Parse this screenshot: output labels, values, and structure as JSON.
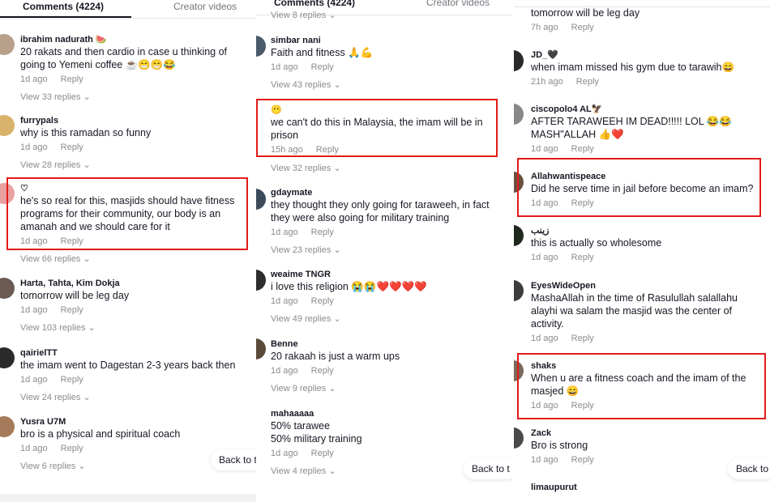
{
  "panel1": {
    "tabs": {
      "comments": "Comments (4224)",
      "creator": "Creator videos"
    },
    "back_label": "Back to t",
    "comments": [
      {
        "author": "ibrahim nadurath 🍉",
        "text": "20 rakats and then cardio in case u thinking of going to Yemeni coffee ☕😁😁😂",
        "time": "1d ago",
        "reply": "Reply",
        "view": "View 33 replies ⌄"
      },
      {
        "author": "furrypals",
        "text": "why is this ramadan so funny",
        "time": "1d ago",
        "reply": "Reply",
        "view": "View 28 replies ⌄"
      },
      {
        "author": "♡",
        "text": "he's so real for this, masjids should have fitness programs for their community, our body is an amanah and we should care for it",
        "time": "1d ago",
        "reply": "Reply",
        "view": "View 66 replies ⌄"
      },
      {
        "author": "Harta, Tahta, Kim Dokja",
        "text": "tomorrow will be leg day",
        "time": "1d ago",
        "reply": "Reply",
        "view": "View 103 replies ⌄"
      },
      {
        "author": "qairielTT",
        "text": "the imam went to Dagestan 2-3 years back then",
        "time": "1d ago",
        "reply": "Reply",
        "view": "View 24 replies ⌄"
      },
      {
        "author": "Yusra U7M",
        "text": "bro is a physical and spiritual coach",
        "time": "1d ago",
        "reply": "Reply",
        "view": "View 6 replies ⌄"
      }
    ]
  },
  "panel2": {
    "tabs": {
      "comments": "Comments (4224)",
      "creator": "Creator videos"
    },
    "top_partial": "View 8 replies ⌄",
    "back_label": "Back to t",
    "comments": [
      {
        "author": "simbar nani",
        "text": "Faith and fitness 🙏💪",
        "time": "1d ago",
        "reply": "Reply",
        "view": "View 43 replies ⌄"
      },
      {
        "author": "😶",
        "text": "we can't do this in Malaysia, the imam will be in prison",
        "time": "15h ago",
        "reply": "Reply",
        "view": "View 32 replies ⌄"
      },
      {
        "author": "gdaymate",
        "text": "they thought they only going for taraweeh, in fact they were also going for military training",
        "time": "1d ago",
        "reply": "Reply",
        "view": "View 23 replies ⌄"
      },
      {
        "author": "weaime TNGR",
        "text": "i love this religion 😭😭❤️❤️❤️❤️",
        "time": "1d ago",
        "reply": "Reply",
        "view": "View 49 replies ⌄"
      },
      {
        "author": "Benne",
        "text": "20 rakaah is just a warm ups",
        "time": "1d ago",
        "reply": "Reply",
        "view": "View 9 replies ⌄"
      },
      {
        "author": "mahaaaaa",
        "text": "50% tarawee\n50% military training",
        "time": "1d ago",
        "reply": "Reply",
        "view": "View 4 replies ⌄"
      }
    ]
  },
  "panel3": {
    "back_label": "Back to",
    "comments": [
      {
        "author": "",
        "text": "tomorrow will be leg day",
        "time": "7h ago",
        "reply": "Reply"
      },
      {
        "author": "JD_🖤",
        "text": "when imam missed his gym due to tarawih😄",
        "time": "21h ago",
        "reply": "Reply"
      },
      {
        "author": "ciscopolo4 AL🦅",
        "text": "AFTER TARAWEEH IM DEAD!!!!! LOL 😂😂 MASH\"ALLAH 👍❤️",
        "time": "1d ago",
        "reply": "Reply"
      },
      {
        "author": "Allahwantispeace",
        "text": "Did he serve time in jail before become an imam?",
        "time": "1d ago",
        "reply": "Reply"
      },
      {
        "author": "زينب",
        "text": "this is actually so wholesome",
        "time": "1d ago",
        "reply": "Reply"
      },
      {
        "author": "EyesWideOpen",
        "text": "MashaAllah in the time of Rasulullah salallahu alayhi wa salam the masjid was the center of activity.",
        "time": "1d ago",
        "reply": "Reply"
      },
      {
        "author": "shaks",
        "text": "When u are a fitness coach and the imam of the masjed 😄",
        "time": "1d ago",
        "reply": "Reply"
      },
      {
        "author": "Zack",
        "text": "Bro is strong",
        "time": "1d ago",
        "reply": "Reply"
      },
      {
        "author": "limaupurut",
        "text": "",
        "time": "",
        "reply": ""
      }
    ]
  },
  "colors": {
    "highlight": "#e41a1a",
    "muted": "#8a8b91",
    "text": "#161823"
  }
}
